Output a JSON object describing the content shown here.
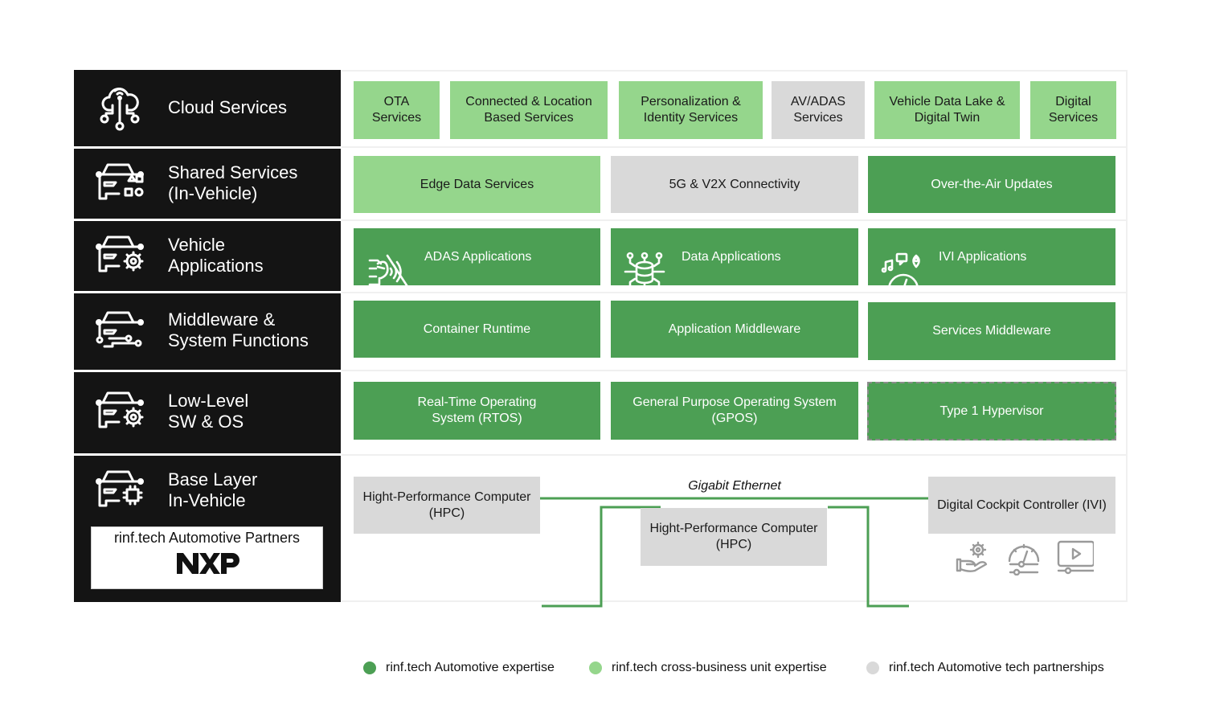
{
  "layers": [
    {
      "label": "Cloud Services",
      "icon": "cloud-network-icon"
    },
    {
      "label": "Shared Services\n(In-Vehicle)",
      "icon": "car-shapes-icon"
    },
    {
      "label": "Vehicle\nApplications",
      "icon": "car-gear-icon"
    },
    {
      "label": "Middleware &\nSystem Functions",
      "icon": "car-circuit-icon"
    },
    {
      "label": "Low-Level\nSW & OS",
      "icon": "car-gear-icon"
    },
    {
      "label": "Base Layer\nIn-Vehicle",
      "icon": "car-chip-icon"
    }
  ],
  "partners": {
    "title": "rinf.tech Automotive Partners",
    "logo": "NXP"
  },
  "cloud_services": [
    {
      "label": "OTA\nServices",
      "category": "cross-business"
    },
    {
      "label": "Connected & Location\nBased Services",
      "category": "cross-business"
    },
    {
      "label": "Personalization &\nIdentity Services",
      "category": "cross-business"
    },
    {
      "label": "AV/ADAS\nServices",
      "category": "partnership"
    },
    {
      "label": "Vehicle Data Lake &\nDigital Twin",
      "category": "cross-business"
    },
    {
      "label": "Digital\nServices",
      "category": "cross-business"
    }
  ],
  "shared_services": [
    {
      "label": "Edge Data Services",
      "category": "cross-business"
    },
    {
      "label": "5G & V2X Connectivity",
      "category": "partnership"
    },
    {
      "label": "Over-the-Air Updates",
      "category": "automotive"
    }
  ],
  "vehicle_apps": [
    {
      "label": "ADAS Applications",
      "icon": "adas-sensor-icon",
      "category": "automotive"
    },
    {
      "label": "Data Applications",
      "icon": "database-network-icon",
      "category": "automotive"
    },
    {
      "label": "IVI Applications",
      "icon": "infotainment-gauge-icon",
      "category": "automotive"
    }
  ],
  "middleware": [
    {
      "label": "Container Runtime",
      "category": "automotive"
    },
    {
      "label": "Application Middleware",
      "category": "automotive"
    },
    {
      "label": "Services Middleware",
      "category": "automotive"
    }
  ],
  "low_level": [
    {
      "label": "Real-Time Operating\nSystem (RTOS)",
      "category": "automotive"
    },
    {
      "label": "General Purpose Operating System\n(GPOS)",
      "category": "automotive"
    },
    {
      "label": "Type 1 Hypervisor",
      "category": "automotive"
    }
  ],
  "base_layer": {
    "hpc_left": "Hight-Performance Computer\n(HPC)",
    "hpc_center": "Hight-Performance Computer\n(HPC)",
    "cockpit": "Digital Cockpit Controller (IVI)",
    "link_label": "Gigabit Ethernet",
    "device_icons": [
      "hand-gear-icon",
      "gauge-slider-icon",
      "video-player-icon"
    ]
  },
  "legend": [
    {
      "label": "rinf.tech Automotive expertise",
      "color": "#4c9f54"
    },
    {
      "label": "rinf.tech cross-business unit expertise",
      "color": "#95d68c"
    },
    {
      "label": "rinf.tech Automotive tech partnerships",
      "color": "#d9d9d9"
    }
  ],
  "colors": {
    "automotive": "#4c9f54",
    "cross_business": "#95d68c",
    "partnership": "#d9d9d9",
    "sidebar": "#141414",
    "link": "#4c9f54"
  }
}
